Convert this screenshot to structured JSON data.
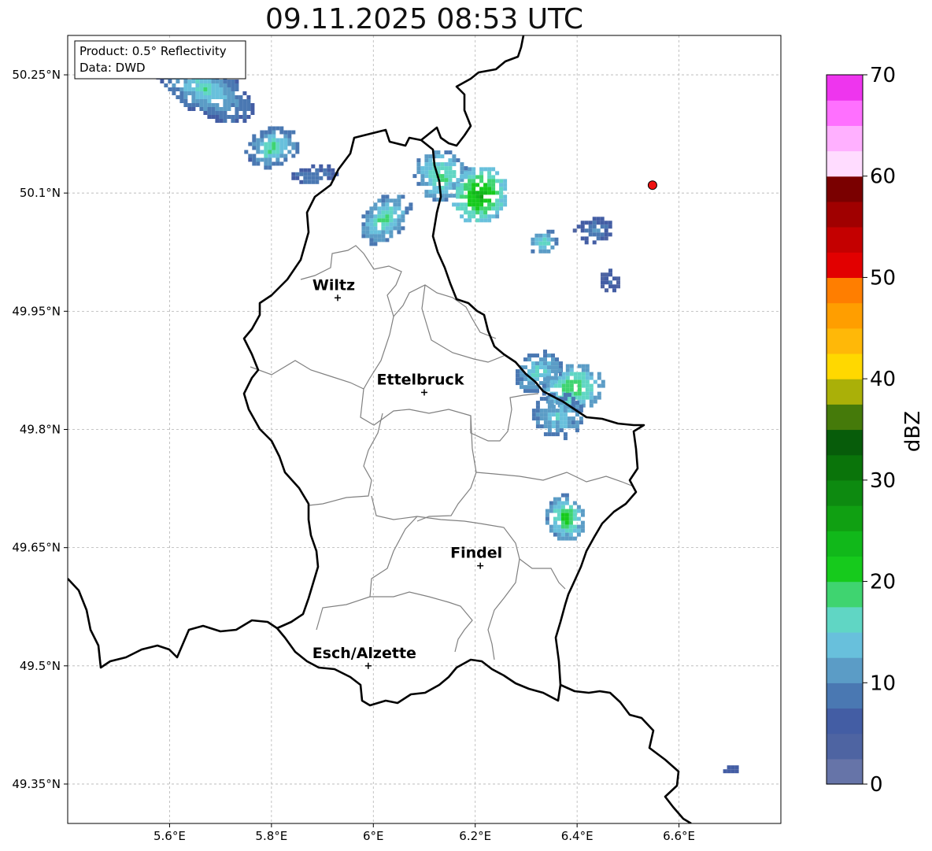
{
  "title": "09.11.2025 08:53 UTC",
  "info_box": {
    "product": "Product: 0.5° Reflectivity",
    "data": "Data: DWD"
  },
  "map": {
    "lon_range": [
      5.4,
      6.8
    ],
    "lat_range": [
      49.3,
      50.3
    ],
    "x_ticks": [
      {
        "value": 5.6,
        "label": "5.6°E"
      },
      {
        "value": 5.8,
        "label": "5.8°E"
      },
      {
        "value": 6.0,
        "label": "6°E"
      },
      {
        "value": 6.2,
        "label": "6.2°E"
      },
      {
        "value": 6.4,
        "label": "6.4°E"
      },
      {
        "value": 6.6,
        "label": "6.6°E"
      }
    ],
    "y_ticks": [
      {
        "value": 49.35,
        "label": "49.35°N"
      },
      {
        "value": 49.5,
        "label": "49.5°N"
      },
      {
        "value": 49.65,
        "label": "49.65°N"
      },
      {
        "value": 49.8,
        "label": "49.8°N"
      },
      {
        "value": 49.95,
        "label": "49.95°N"
      },
      {
        "value": 50.1,
        "label": "50.1°N"
      },
      {
        "value": 50.25,
        "label": "50.25°N"
      }
    ],
    "grid": true,
    "cities": [
      {
        "name": "Wiltz",
        "lon": 5.93,
        "lat": 49.967
      },
      {
        "name": "Ettelbruck",
        "lon": 6.1,
        "lat": 49.847
      },
      {
        "name": "Findel",
        "lon": 6.21,
        "lat": 49.627
      },
      {
        "name": "Esch/Alzette",
        "lon": 5.99,
        "lat": 49.5
      }
    ],
    "radar_marker": {
      "lon": 6.548,
      "lat": 50.11,
      "color": "#ee1111"
    }
  },
  "colorbar": {
    "label": "dBZ",
    "vmin": 0,
    "vmax": 70,
    "step": 2.5,
    "ticks": [
      "0",
      "10",
      "20",
      "30",
      "40",
      "50",
      "60",
      "70"
    ],
    "colors": [
      "#6674a8",
      "#4e64a2",
      "#435da4",
      "#4a78b2",
      "#5b9cc6",
      "#68c0dc",
      "#60d6c4",
      "#3fd470",
      "#16ca1c",
      "#11b81a",
      "#10a012",
      "#0d8a10",
      "#0a740a",
      "#075c0a",
      "#457a0a",
      "#aab008",
      "#ffd800",
      "#ffb808",
      "#ff9e00",
      "#ff7e00",
      "#e20000",
      "#c40000",
      "#a00000",
      "#7a0000",
      "#ffdcff",
      "#ffb0ff",
      "#ff70ff",
      "#ee35ee"
    ]
  },
  "echoes": [
    {
      "lon": 5.665,
      "lat": 50.235,
      "dx": 0.05,
      "dy": 0.07,
      "rot": -60,
      "dbz": 6,
      "core": 17
    },
    {
      "lon": 5.8,
      "lat": 50.16,
      "dx": 0.055,
      "dy": 0.025,
      "rot": -15,
      "dbz": 7,
      "core": 19
    },
    {
      "lon": 5.88,
      "lat": 50.125,
      "dx": 0.05,
      "dy": 0.012,
      "rot": -10,
      "dbz": 5,
      "core": 11
    },
    {
      "lon": 6.02,
      "lat": 50.07,
      "dx": 0.06,
      "dy": 0.025,
      "rot": -45,
      "dbz": 8,
      "core": 19
    },
    {
      "lon": 6.13,
      "lat": 50.125,
      "dx": 0.05,
      "dy": 0.035,
      "rot": -60,
      "dbz": 9,
      "core": 20
    },
    {
      "lon": 6.205,
      "lat": 50.1,
      "dx": 0.06,
      "dy": 0.035,
      "rot": -50,
      "dbz": 12,
      "core": 26
    },
    {
      "lon": 6.33,
      "lat": 50.04,
      "dx": 0.03,
      "dy": 0.015,
      "rot": -20,
      "dbz": 8,
      "core": 18
    },
    {
      "lon": 6.43,
      "lat": 50.055,
      "dx": 0.04,
      "dy": 0.015,
      "rot": -10,
      "dbz": 5,
      "core": 10
    },
    {
      "lon": 6.46,
      "lat": 49.99,
      "dx": 0.02,
      "dy": 0.015,
      "rot": -30,
      "dbz": 4,
      "core": 7
    },
    {
      "lon": 6.32,
      "lat": 49.875,
      "dx": 0.05,
      "dy": 0.025,
      "rot": -30,
      "dbz": 8,
      "core": 17
    },
    {
      "lon": 6.39,
      "lat": 49.855,
      "dx": 0.06,
      "dy": 0.03,
      "rot": -10,
      "dbz": 10,
      "core": 21
    },
    {
      "lon": 6.36,
      "lat": 49.82,
      "dx": 0.05,
      "dy": 0.03,
      "rot": -5,
      "dbz": 8,
      "core": 15
    },
    {
      "lon": 6.375,
      "lat": 49.69,
      "dx": 0.04,
      "dy": 0.03,
      "rot": -10,
      "dbz": 9,
      "core": 22
    },
    {
      "lon": 6.7,
      "lat": 49.37,
      "dx": 0.015,
      "dy": 0.005,
      "rot": 0,
      "dbz": 6,
      "core": 6
    }
  ]
}
